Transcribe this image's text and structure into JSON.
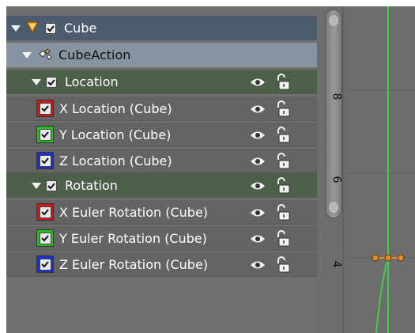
{
  "colors": {
    "object_row": "#4c5b6d",
    "action_row": "#8693a0",
    "group_row": "#4c5f49",
    "channel_row": "#646464",
    "x_channel": "#d01818",
    "y_channel": "#20c020",
    "z_channel": "#1a2ed0",
    "curve": "#47c64a",
    "keyframe": "#e08a2a"
  },
  "channels": {
    "object": {
      "label": "Cube",
      "icon": "object-data-icon",
      "checked": true
    },
    "action": {
      "label": "CubeAction",
      "icon": "action-icon"
    },
    "groups": [
      {
        "label": "Location",
        "checked": true,
        "channels": [
          {
            "label": "X Location (Cube)",
            "color": "#d01818",
            "checked": true
          },
          {
            "label": "Y Location (Cube)",
            "color": "#20c020",
            "checked": true
          },
          {
            "label": "Z Location (Cube)",
            "color": "#1a2ed0",
            "checked": true
          }
        ]
      },
      {
        "label": "Rotation",
        "checked": true,
        "channels": [
          {
            "label": "X Euler Rotation (Cube)",
            "color": "#d01818",
            "checked": true
          },
          {
            "label": "Y Euler Rotation (Cube)",
            "color": "#20c020",
            "checked": true
          },
          {
            "label": "Z Euler Rotation (Cube)",
            "color": "#1a2ed0",
            "checked": true
          }
        ]
      }
    ]
  },
  "graph": {
    "y_ticks": [
      "8",
      "6",
      "4"
    ]
  }
}
